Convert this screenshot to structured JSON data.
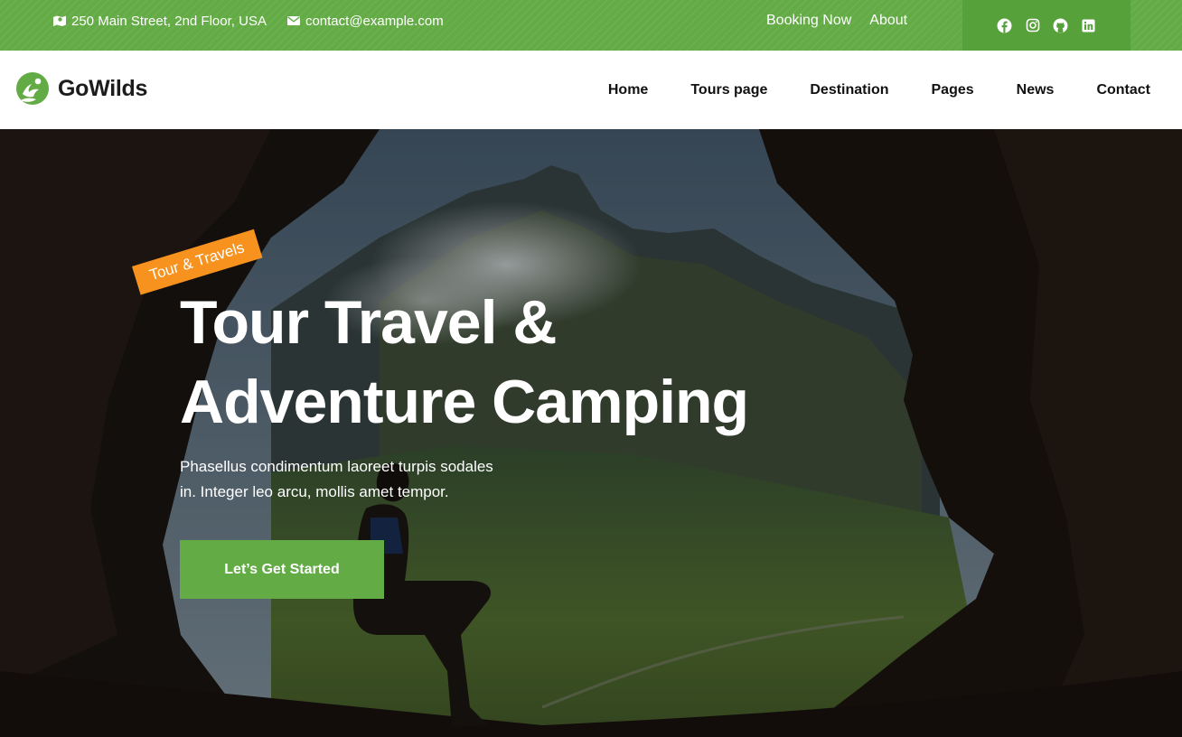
{
  "topbar": {
    "address": "250 Main Street, 2nd Floor, USA",
    "email": "contact@example.com",
    "links": [
      "Booking Now",
      "About"
    ],
    "social_icons": [
      "facebook-icon",
      "instagram-icon",
      "github-icon",
      "linkedin-icon"
    ]
  },
  "brand": {
    "name": "GoWilds"
  },
  "nav": [
    "Home",
    "Tours page",
    "Destination",
    "Pages",
    "News",
    "Contact"
  ],
  "hero": {
    "tag": "Tour & Travels",
    "title_line1": "Tour Travel &",
    "title_line2": "Adventure Camping",
    "subtitle_line1": "Phasellus condimentum laoreet turpis sodales",
    "subtitle_line2": "in. Integer leo arcu, mollis amet tempor.",
    "cta": "Let’s Get Started"
  },
  "colors": {
    "brand_green": "#63ab45",
    "tag_orange": "#f7921e",
    "text_dark": "#111111"
  }
}
